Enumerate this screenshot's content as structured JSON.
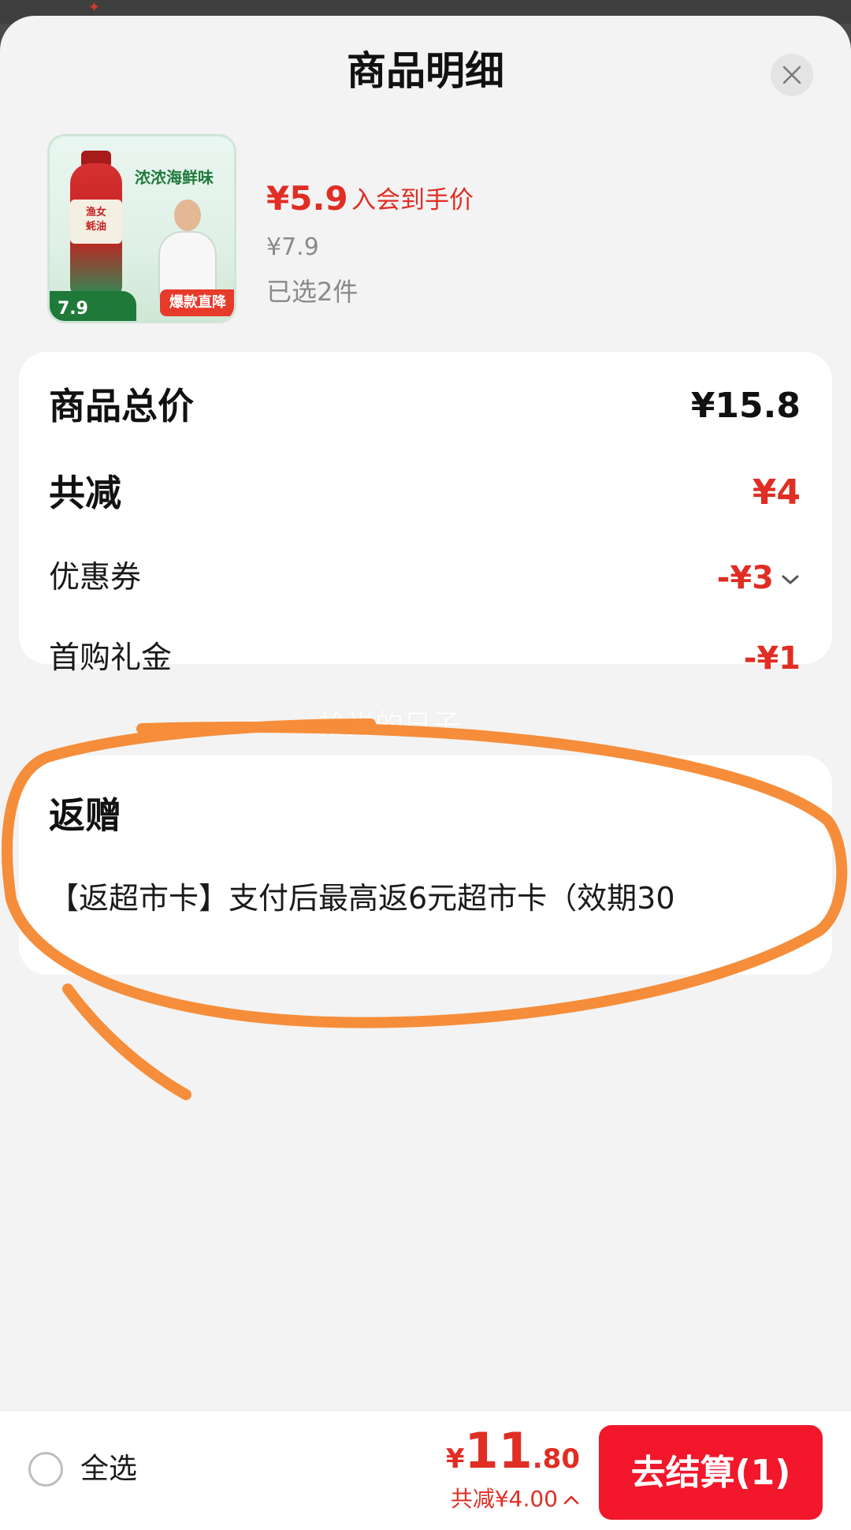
{
  "sheet": {
    "title": "商品明细",
    "close_icon": "close-icon"
  },
  "product": {
    "thumbnail": {
      "bottle_label": "渔女\n蚝油",
      "banner_text": "浓浓海鲜味",
      "promo_text": "爆款直降",
      "price_text": "7.9"
    },
    "member_price": "¥5.9",
    "member_price_tag": "入会到手价",
    "original_price": "¥7.9",
    "selected_count": "已选2件"
  },
  "summary": {
    "total_label": "商品总价",
    "total_value": "¥15.8",
    "discount_label": "共减",
    "discount_value": "¥4",
    "coupon_label": "优惠券",
    "coupon_value": "-¥3",
    "first_buy_label": "首购礼金",
    "first_buy_value": "-¥1"
  },
  "watermark": "拾光的日子",
  "rebate": {
    "title": "返赠",
    "text": "【返超市卡】支付后最高返6元超市卡（效期30"
  },
  "bottom_bar": {
    "select_all_label": "全选",
    "total_currency": "¥",
    "total_integer": "11",
    "total_decimal": ".80",
    "discount_summary": "共减¥4.00",
    "checkout_label": "去结算(1)"
  },
  "colors": {
    "accent_red": "#e02e24",
    "checkout_red": "#f3172b",
    "annotation_orange": "#f58d3a",
    "sheet_bg": "#f3f3f3"
  }
}
